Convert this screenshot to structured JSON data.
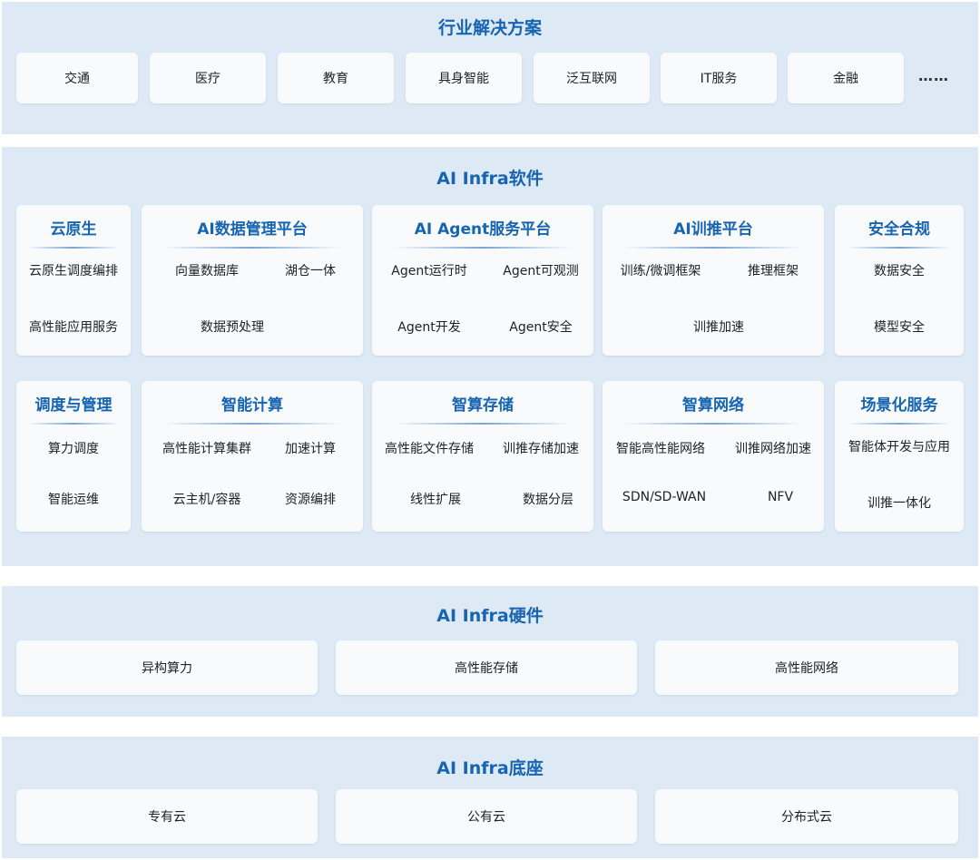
{
  "industry": {
    "title": "行业解决方案",
    "items": [
      "交通",
      "医疗",
      "教育",
      "具身智能",
      "泛互联网",
      "IT服务",
      "金融"
    ],
    "more": "……"
  },
  "software": {
    "title": "AI Infra软件",
    "cards": [
      {
        "title": "云原生",
        "items": [
          "云原生调度编排",
          "高性能应用服务"
        ]
      },
      {
        "title": "AI数据管理平台",
        "items": [
          "向量数据库",
          "湖仓一体",
          "数据预处理"
        ]
      },
      {
        "title": "AI Agent服务平台",
        "items": [
          "Agent运行时",
          "Agent可观测",
          "Agent开发",
          "Agent安全"
        ]
      },
      {
        "title": "AI训推平台",
        "items": [
          "训练/微调框架",
          "推理框架",
          "训推加速"
        ]
      },
      {
        "title": "安全合规",
        "items": [
          "数据安全",
          "模型安全"
        ]
      },
      {
        "title": "调度与管理",
        "items": [
          "算力调度",
          "智能运维"
        ]
      },
      {
        "title": "智能计算",
        "items": [
          "高性能计算集群",
          "加速计算",
          "云主机/容器",
          "资源编排"
        ]
      },
      {
        "title": "智算存储",
        "items": [
          "高性能文件存储",
          "训推存储加速",
          "线性扩展",
          "数据分层"
        ]
      },
      {
        "title": "智算网络",
        "items": [
          "智能高性能网络",
          "训推网络加速",
          "SDN/SD-WAN",
          "NFV"
        ]
      },
      {
        "title": "场景化服务",
        "items": [
          "智能体开发与应用",
          "训推一体化"
        ]
      }
    ]
  },
  "hardware": {
    "title": "AI Infra硬件",
    "items": [
      "异构算力",
      "高性能存储",
      "高性能网络"
    ]
  },
  "base": {
    "title": "AI Infra底座",
    "items": [
      "专有云",
      "公有云",
      "分布式云"
    ]
  }
}
